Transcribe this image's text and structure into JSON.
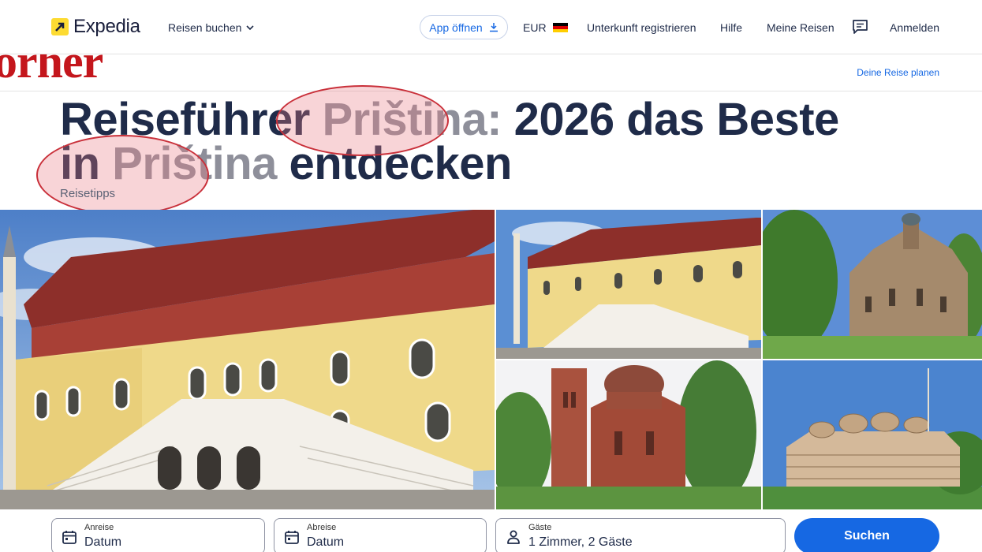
{
  "header": {
    "logo_text": "Expedia",
    "reisen_label": "Reisen buchen",
    "app_label": "App öffnen",
    "currency": "EUR",
    "unterkunft": "Unterkunft registrieren",
    "hilfe": "Hilfe",
    "meine_reisen": "Meine Reisen",
    "anmelden": "Anmelden",
    "accent": "#1668e3",
    "logo_color": "#fddb32"
  },
  "masthead": "orher",
  "plan_link": "Deine Reise planen",
  "title": {
    "part1": "Reiseführer ",
    "city1": "Priština:",
    "part2": " 2026 das Beste in ",
    "city2": "Priština",
    "part3": " entdecken"
  },
  "subtitle": "Reisetipps",
  "gallery": {
    "main": "kosovo-museum-photo",
    "thumbs": [
      "kosovo-museum-photo",
      "gracanica-monastery-photo",
      "christ-the-saviour-cathedral-photo",
      "national-library-photo"
    ]
  },
  "search": {
    "checkin_label": "Anreise",
    "checkin_value": "Datum",
    "checkout_label": "Abreise",
    "checkout_value": "Datum",
    "guests_label": "Gäste",
    "guests_value": "1 Zimmer, 2 Gäste",
    "button": "Suchen"
  }
}
